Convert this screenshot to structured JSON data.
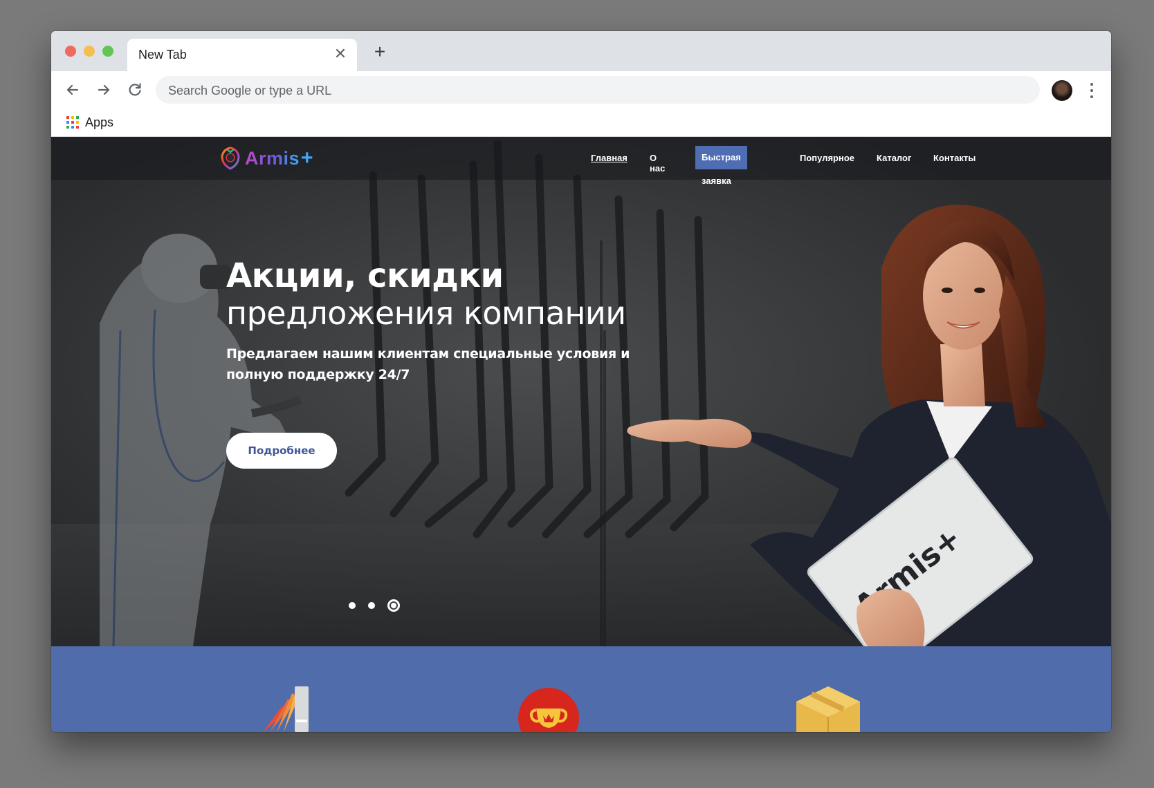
{
  "browser": {
    "tab_title": "New Tab",
    "omnibox_placeholder": "Search Google or type a URL",
    "bookmark_apps_label": "Apps",
    "icons": [
      "close-icon",
      "plus-icon",
      "back-arrow-icon",
      "forward-arrow-icon",
      "reload-icon",
      "profile-avatar",
      "more-vert-icon",
      "apps-grid-icon"
    ]
  },
  "site": {
    "logo_text": "Armis",
    "logo_plus": "+",
    "nav": {
      "home": "Главная",
      "about": "О нас",
      "quick_request": "Быстрая заявка",
      "popular": "Популярное",
      "catalog": "Каталог",
      "contacts": "Контакты"
    },
    "hero": {
      "title_bold": "Акции, скидки",
      "title_light": "предложения компании",
      "subtitle": "Предлагаем нашим клиентам специальные условия и полную поддержку 24/7",
      "button": "Подробнее",
      "folder_text": "Armis+",
      "slides_total": 3,
      "slide_active": 3
    },
    "features": {
      "icons": [
        "color-palette-icon",
        "trophy-icon",
        "box-icon"
      ]
    },
    "colors": {
      "accent_blue": "#4e6db2",
      "band_blue": "#506cab",
      "button_text": "#3f579a"
    }
  }
}
